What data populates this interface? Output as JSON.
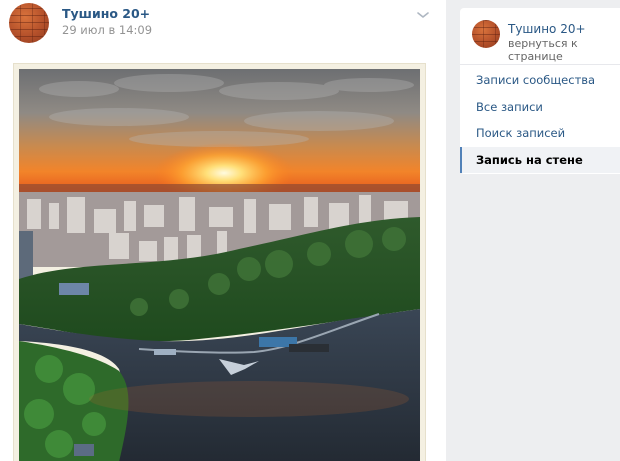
{
  "post": {
    "author": "Тушино 20+",
    "date": "29 июл в 14:09",
    "menu_icon": "chevron-down-icon",
    "photo_description_icon": "photo"
  },
  "sidebar": {
    "community_name": "Тушино 20+",
    "back_link": "вернуться к странице",
    "items": [
      {
        "label": "Записи сообщества",
        "active": false
      },
      {
        "label": "Все записи",
        "active": false
      },
      {
        "label": "Поиск записей",
        "active": false
      },
      {
        "label": "Запись на стене",
        "active": true
      }
    ]
  },
  "colors": {
    "link": "#2a5885",
    "muted": "#939393",
    "active_border": "#5181b8",
    "page_bg": "#edeef0"
  }
}
